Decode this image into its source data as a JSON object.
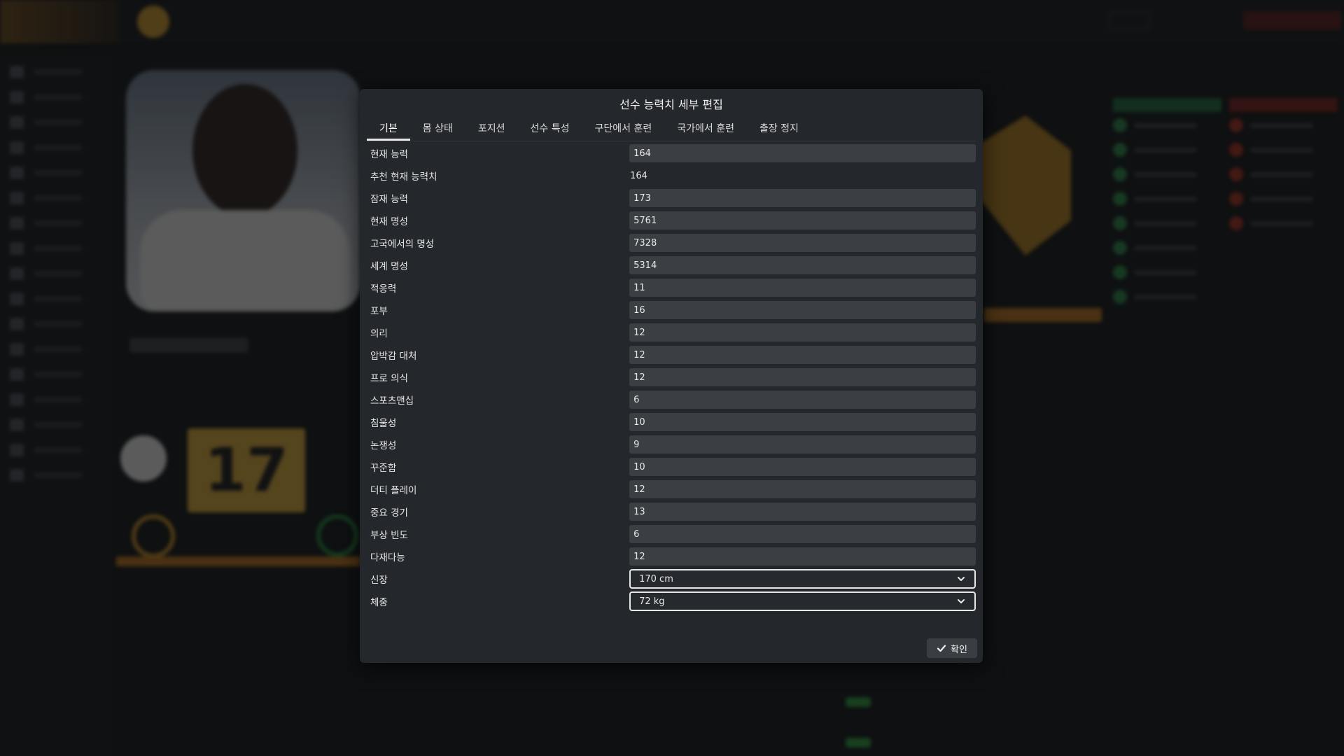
{
  "background": {
    "jersey_number": "17"
  },
  "modal": {
    "title": "선수 능력치 세부 편집",
    "tabs": [
      {
        "label": "기본",
        "active": true
      },
      {
        "label": "몸 상태",
        "active": false
      },
      {
        "label": "포지션",
        "active": false
      },
      {
        "label": "선수 특성",
        "active": false
      },
      {
        "label": "구단에서 훈련",
        "active": false
      },
      {
        "label": "국가에서 훈련",
        "active": false
      },
      {
        "label": "출장 정지",
        "active": false
      }
    ],
    "fields": [
      {
        "label": "현재 능력",
        "value": "164"
      },
      {
        "label": "추천 현재 능력치",
        "value": "164"
      },
      {
        "label": "잠재 능력",
        "value": "173"
      },
      {
        "label": "현재 명성",
        "value": "5761"
      },
      {
        "label": "고국에서의 명성",
        "value": "7328"
      },
      {
        "label": "세계 명성",
        "value": "5314"
      },
      {
        "label": "적응력",
        "value": "11"
      },
      {
        "label": "포부",
        "value": "16"
      },
      {
        "label": "의리",
        "value": "12"
      },
      {
        "label": "압박감 대처",
        "value": "12"
      },
      {
        "label": "프로 의식",
        "value": "12"
      },
      {
        "label": "스포츠맨십",
        "value": "6"
      },
      {
        "label": "침울성",
        "value": "10"
      },
      {
        "label": "논쟁성",
        "value": "9"
      },
      {
        "label": "꾸준함",
        "value": "10"
      },
      {
        "label": "더티 플레이",
        "value": "12"
      },
      {
        "label": "중요 경기",
        "value": "13"
      },
      {
        "label": "부상 빈도",
        "value": "6"
      },
      {
        "label": "다재다능",
        "value": "12"
      }
    ],
    "selects": [
      {
        "label": "신장",
        "value": "170 cm"
      },
      {
        "label": "체중",
        "value": "72 kg"
      }
    ],
    "confirm_label": "확인"
  }
}
